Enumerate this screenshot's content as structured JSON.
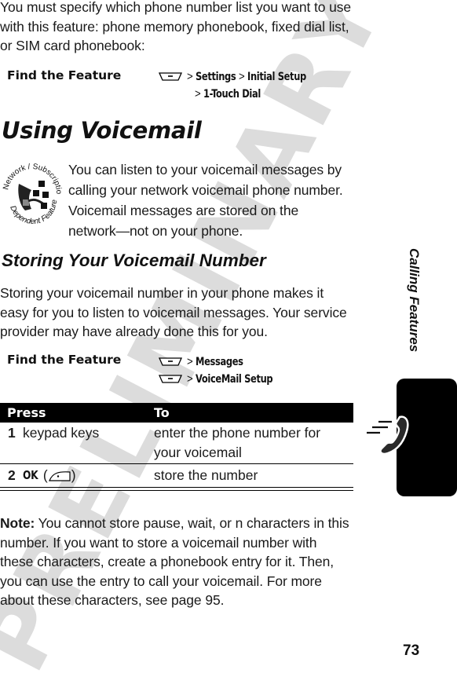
{
  "watermark": "PRELIMINARY",
  "intro_paragraph": [
    "You must specify which phone number list you want to use",
    "with this feature: phone memory phonebook, fixed dial list,",
    "or SIM card phonebook:"
  ],
  "find_feature_1": {
    "label": "Find the Feature",
    "key_icon": "menu-key-icon",
    "path_line_1": [
      "Settings",
      "Initial Setup"
    ],
    "path_line_2": [
      "1-Touch Dial"
    ],
    "separator": ">"
  },
  "section_heading": "Using Voicemail",
  "network_badge": {
    "icon": "network-subscription-dependent-feature-icon",
    "top_text": "Network / Subscription",
    "bottom_text": "Dependent Feature"
  },
  "voicemail_paragraph": [
    "You can listen to your voicemail messages by",
    "calling your network voicemail phone number.",
    "Voicemail messages are stored on the",
    "network—not on your phone."
  ],
  "subsection_heading": "Storing Your Voicemail Number",
  "storing_paragraph": [
    "Storing your voicemail number in your phone makes it",
    "easy for you to listen to voicemail messages. Your service",
    "provider may have already done this for you."
  ],
  "find_feature_2": {
    "label": "Find the Feature",
    "key_icon": "menu-key-icon",
    "steps": [
      "Messages",
      "VoiceMail Setup"
    ],
    "separator": ">"
  },
  "press_table": {
    "headers": [
      "Press",
      "To"
    ],
    "rows": [
      {
        "num": "1",
        "press": "keypad keys",
        "to_lines": [
          "enter the phone number for",
          "your voicemail"
        ]
      },
      {
        "num": "2",
        "press": "OK",
        "press_icon": "right-soft-key-icon",
        "to_lines": [
          "store the number"
        ]
      }
    ]
  },
  "note": {
    "label": "Note:",
    "lines": [
      " You cannot store pause, wait, or n characters in this",
      "number. If you want to store a voicemail number with",
      "these characters, create a phonebook entry for it. Then,",
      "you can use the entry to call your voicemail. For more",
      "about these characters, see page 95."
    ]
  },
  "side_label": "Calling Features",
  "side_icon": "phone-call-icon",
  "page_number": "73"
}
